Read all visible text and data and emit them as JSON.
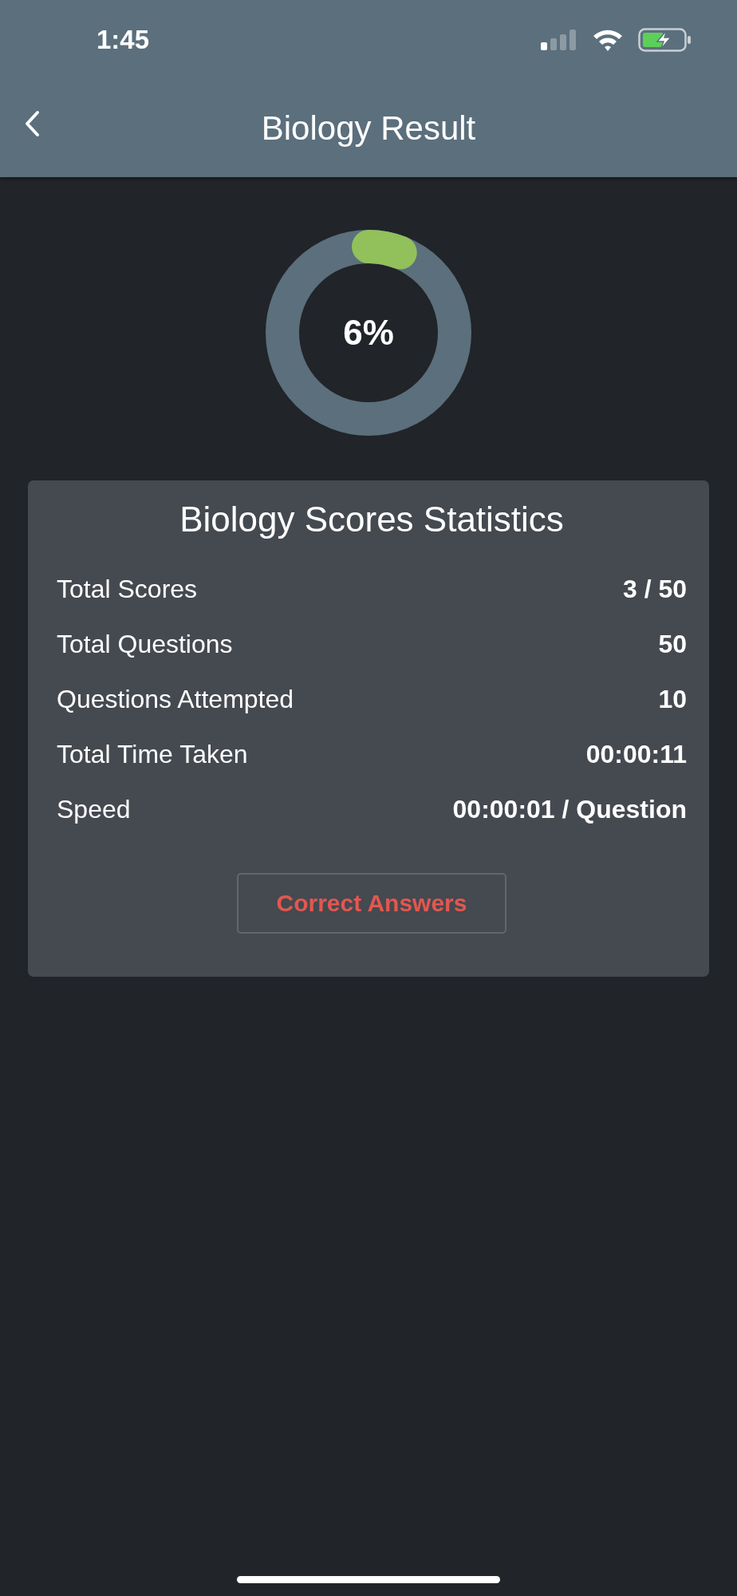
{
  "status_bar": {
    "time": "1:45"
  },
  "header": {
    "title": "Biology Result"
  },
  "result": {
    "percent": "6%"
  },
  "stats": {
    "title": "Biology Scores Statistics",
    "rows": [
      {
        "label": "Total Scores",
        "value": "3 / 50"
      },
      {
        "label": "Total Questions",
        "value": "50"
      },
      {
        "label": "Questions Attempted",
        "value": "10"
      },
      {
        "label": "Total Time Taken",
        "value": "00:00:11"
      },
      {
        "label": "Speed",
        "value": "00:00:01 / Question"
      }
    ],
    "button": "Correct Answers"
  }
}
